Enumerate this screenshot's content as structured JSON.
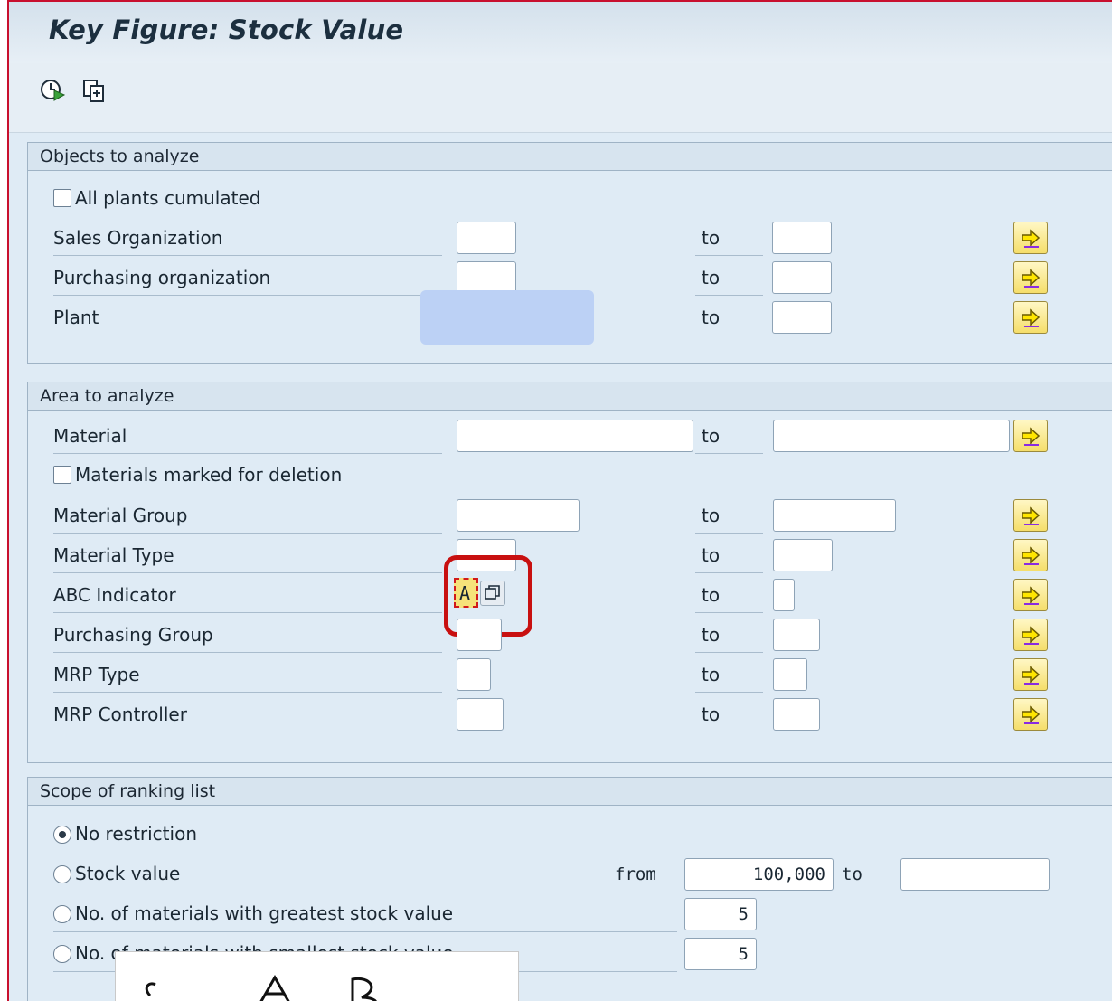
{
  "window": {
    "title": "Key Figure: Stock Value"
  },
  "toolbar": {
    "execute_icon": "execute-clock-icon",
    "copy_icon": "copy-variant-icon"
  },
  "objects": {
    "header": "Objects to analyze",
    "all_plants_label": "All plants cumulated",
    "rows": [
      {
        "label": "Sales Organization",
        "to": "to"
      },
      {
        "label": "Purchasing organization",
        "to": "to"
      },
      {
        "label": "Plant",
        "to": "to"
      }
    ]
  },
  "area": {
    "header": "Area to analyze",
    "material_label": "Material",
    "material_to": "to",
    "deletion_label": "Materials marked for deletion",
    "rows": [
      {
        "label": "Material Group",
        "to": "to"
      },
      {
        "label": "Material Type",
        "to": "to"
      },
      {
        "label": "ABC Indicator",
        "to": "to"
      },
      {
        "label": "Purchasing Group",
        "to": "to"
      },
      {
        "label": "MRP Type",
        "to": "to"
      },
      {
        "label": "MRP Controller",
        "to": "to"
      }
    ],
    "abc_glyph": "A"
  },
  "scope": {
    "header": "Scope of ranking list",
    "options": [
      {
        "label": "No restriction",
        "selected": true
      },
      {
        "label": "Stock value",
        "selected": false
      },
      {
        "label": "No. of materials with greatest stock value",
        "selected": false
      },
      {
        "label": "No. of materials with smallest stock value",
        "selected": false
      }
    ],
    "from_label": "from",
    "from_value": "100,000",
    "to_label": "to",
    "greatest_count": "5",
    "smallest_count": "5"
  },
  "colors": {
    "accent_frame": "#c8102e",
    "callout": "#c81010",
    "multi_button": "#f5de6a"
  }
}
